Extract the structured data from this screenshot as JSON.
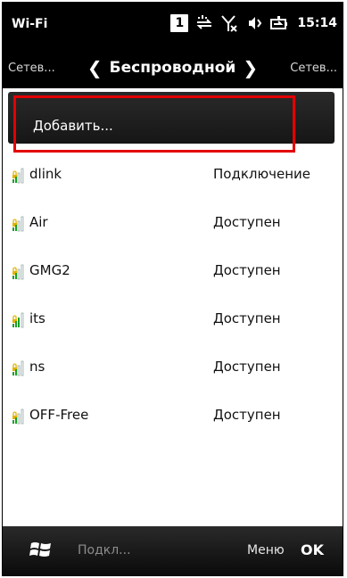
{
  "status": {
    "app_title": "Wi-Fi",
    "badge": "1",
    "time": "15:14",
    "icons": [
      "notification-badge-icon",
      "data-transfer-icon",
      "no-signal-icon",
      "volume-icon",
      "battery-charging-icon"
    ]
  },
  "pivot": {
    "left": "Сетев...",
    "center": "Беспроводной",
    "right": "Сетев..."
  },
  "list": {
    "add_label": "Добавить...",
    "networks": [
      {
        "name": "dlink",
        "status": "Подключение"
      },
      {
        "name": "Air",
        "status": "Доступен"
      },
      {
        "name": "GMG2",
        "status": "Доступен"
      },
      {
        "name": "its",
        "status": "Доступен"
      },
      {
        "name": "ns",
        "status": "Доступен"
      },
      {
        "name": "OFF-Free",
        "status": "Доступен"
      }
    ]
  },
  "softkeys": {
    "left": "Подкл...",
    "menu": "Меню",
    "ok": "OK"
  },
  "colors": {
    "highlight": "#e30000",
    "signal_green": "#1aa028",
    "lock_yellow": "#e1b400"
  }
}
